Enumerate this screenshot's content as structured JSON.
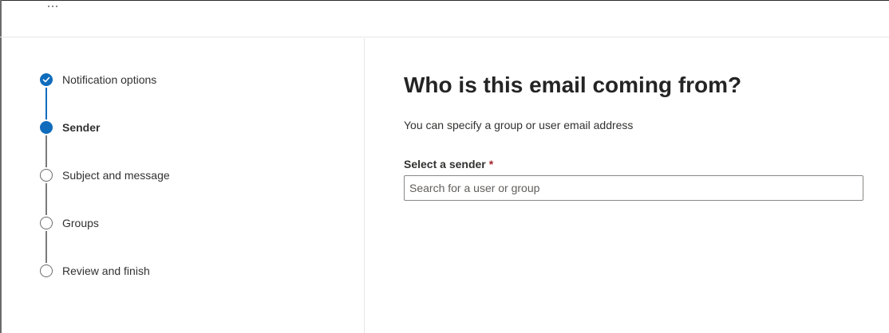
{
  "header": {
    "more_icon": "more-horizontal-icon"
  },
  "wizard": {
    "steps": [
      {
        "label": "Notification options",
        "state": "done"
      },
      {
        "label": "Sender",
        "state": "current"
      },
      {
        "label": "Subject and message",
        "state": "pending"
      },
      {
        "label": "Groups",
        "state": "pending"
      },
      {
        "label": "Review and finish",
        "state": "pending"
      }
    ]
  },
  "main": {
    "title": "Who is this email coming from?",
    "description": "You can specify a group or user email address",
    "sender_field": {
      "label": "Select a sender",
      "required_marker": "*",
      "placeholder": "Search for a user or group",
      "value": ""
    }
  },
  "colors": {
    "accent": "#0f6cbd",
    "required": "#a4262c"
  }
}
